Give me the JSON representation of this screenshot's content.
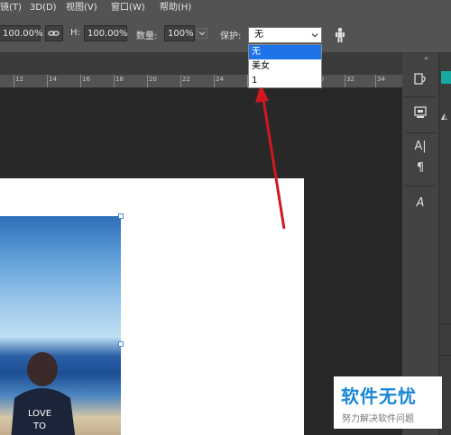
{
  "menubar": {
    "items": [
      "镜(T)",
      "3D(D)",
      "视图(V)",
      "窗口(W)",
      "帮助(H)"
    ]
  },
  "options": {
    "width_value": "100.00%",
    "h_label": "H:",
    "height_value": "100.00%",
    "count_label": "数量:",
    "count_value": "100%",
    "protect_label": "保护:",
    "protect_value": "无",
    "protect_options": [
      "无",
      "美女",
      "1"
    ]
  },
  "ruler": {
    "labels": [
      "12",
      "14",
      "16",
      "18",
      "20",
      "22",
      "24",
      "26",
      "28",
      "30",
      "32",
      "34"
    ]
  },
  "photo": {
    "shirt_text_line1": "LOVE",
    "shirt_text_line2": "TO"
  },
  "watermark": {
    "title": "软件无忧",
    "subtitle": "努力解决软件问题"
  },
  "colors": {
    "arrow": "#d0181e",
    "selection": "#1e73e8",
    "watermark_blue": "#1a87d6"
  }
}
